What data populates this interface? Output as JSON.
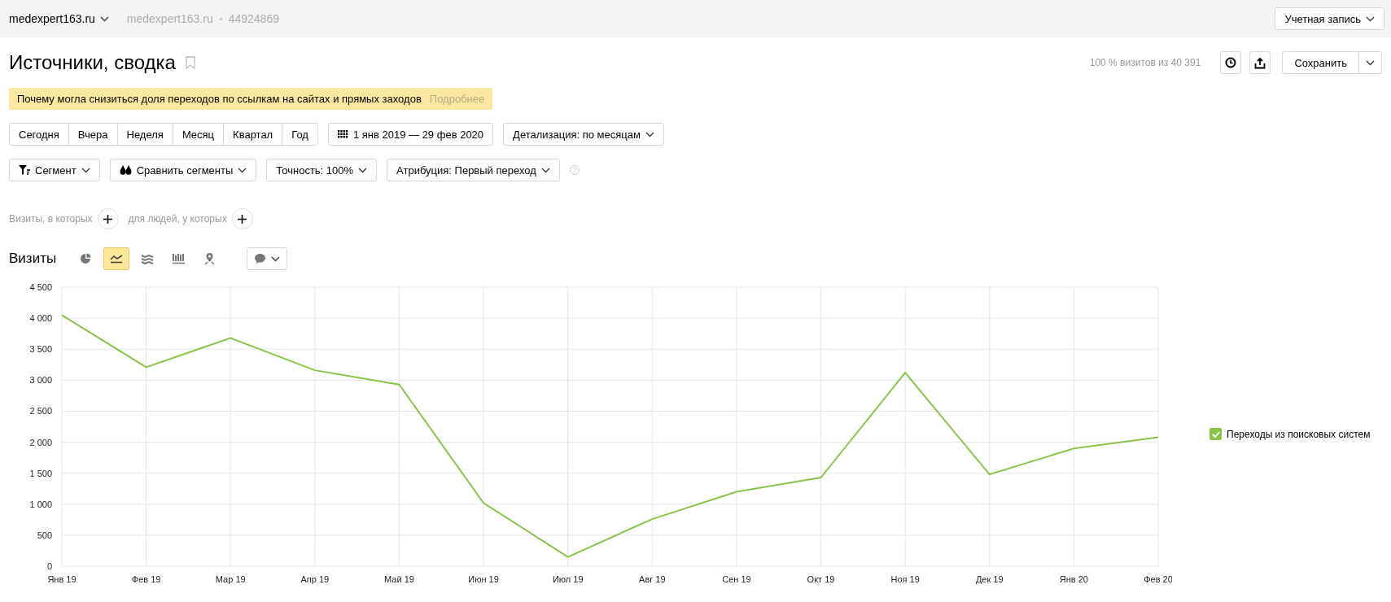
{
  "top_bar": {
    "site": "medexpert163.ru",
    "counter_site": "medexpert163.ru",
    "counter_id": "44924869",
    "account_button": "Учетная запись"
  },
  "header": {
    "title": "Источники, сводка",
    "visits_share": "100 % визитов из 40 391",
    "save_button": "Сохранить"
  },
  "notice": {
    "text": "Почему могла снизиться доля переходов по ссылкам на сайтах и прямых заходов",
    "link": "Подробнее"
  },
  "periods": [
    {
      "label": "Сегодня",
      "selected": false
    },
    {
      "label": "Вчера",
      "selected": false
    },
    {
      "label": "Неделя",
      "selected": false
    },
    {
      "label": "Месяц",
      "selected": false
    },
    {
      "label": "Квартал",
      "selected": false
    },
    {
      "label": "Год",
      "selected": false
    }
  ],
  "date_range": "1 янв 2019 — 29 фев 2020",
  "detail": "Детализация: по месяцам",
  "filters": [
    {
      "kind": "segment",
      "label": "Сегмент"
    },
    {
      "kind": "compare",
      "label": "Сравнить сегменты"
    },
    {
      "kind": "plain",
      "label": "Точность: 100%"
    },
    {
      "kind": "plain",
      "label": "Атрибуция: Первый переход"
    }
  ],
  "segment_builder": {
    "visits_label": "Визиты, в которых",
    "people_label": "для людей, у которых"
  },
  "chart_section": {
    "title": "Визиты",
    "chart_types": [
      {
        "kind": "pie",
        "selected": false
      },
      {
        "kind": "line",
        "selected": true
      },
      {
        "kind": "area",
        "selected": false
      },
      {
        "kind": "bars",
        "selected": false
      },
      {
        "kind": "map",
        "selected": false
      }
    ],
    "legend": [
      {
        "checked": true
      }
    ],
    "chart_data": {
      "type": "line",
      "categories": [
        "Янв 19",
        "Фев 19",
        "Мар 19",
        "Апр 19",
        "Май 19",
        "Июн 19",
        "Июл 19",
        "Авг 19",
        "Сен 19",
        "Окт 19",
        "Ноя 19",
        "Дек 19",
        "Янв 20",
        "Фев 20"
      ],
      "series": [
        {
          "name": "Переходы из поисковых систем",
          "color": "#8bc34a",
          "values": [
            4050,
            3210,
            3680,
            3160,
            2930,
            1020,
            150,
            760,
            1200,
            1430,
            3120,
            1480,
            1900,
            2080
          ]
        }
      ],
      "ylim": [
        0,
        4500
      ],
      "grid": true,
      "yticks": [
        0,
        500,
        {
          "value": 1000,
          "label": "1 000"
        },
        {
          "value": 1500,
          "label": "1 500"
        },
        {
          "value": 2000,
          "label": "2 000"
        },
        {
          "value": 2500,
          "label": "2 500"
        },
        {
          "value": 3000,
          "label": "3 000"
        },
        {
          "value": 3500,
          "label": "3 500"
        },
        {
          "value": 4000,
          "label": "4 000"
        },
        {
          "value": 4500,
          "label": "4 500"
        }
      ]
    }
  }
}
